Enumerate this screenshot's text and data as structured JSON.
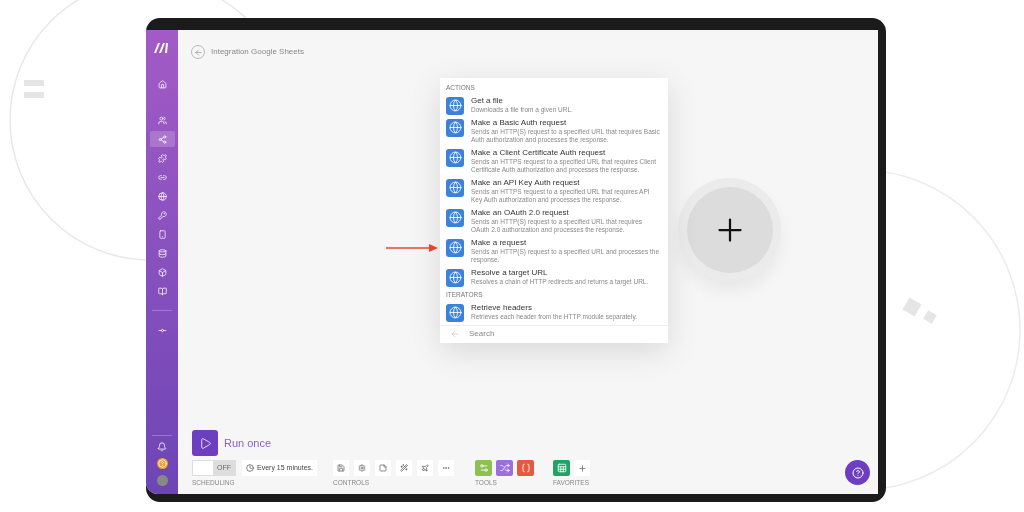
{
  "breadcrumb": "Integration Google Sheets",
  "sidebar": {
    "items": [
      {
        "selected": false
      },
      {
        "selected": false
      },
      {
        "selected": true
      },
      {
        "selected": false
      },
      {
        "selected": false
      },
      {
        "selected": false
      },
      {
        "selected": false
      },
      {
        "selected": false
      },
      {
        "selected": false
      },
      {
        "selected": false
      },
      {
        "selected": false
      },
      {
        "selected": false
      }
    ]
  },
  "module_menu": {
    "sections": [
      {
        "title": "ACTIONS",
        "items": [
          {
            "name": "Get a file",
            "description": "Downloads a file from a given URL."
          },
          {
            "name": "Make a Basic Auth request",
            "description": "Sends an HTTP(S) request to a specified URL that requires Basic Auth authorization and processes the response."
          },
          {
            "name": "Make a Client Certificate Auth request",
            "description": "Sends an HTTPS request to a specified URL that requires Client Certificate Auth authorization and processes the response."
          },
          {
            "name": "Make an API Key Auth request",
            "description": "Sends an HTTPS request to a specified URL that requires API Key Auth authorization and processes the response."
          },
          {
            "name": "Make an OAuth 2.0 request",
            "description": "Sends an HTTP(S) request to a specified URL that requires OAuth 2.0 authorization and processes the response."
          },
          {
            "name": "Make a request",
            "description": "Sends an HTTP(S) request to a specified URL and processes the response."
          },
          {
            "name": "Resolve a target URL",
            "description": "Resolves a chain of HTTP redirects and returns a target URL."
          }
        ]
      },
      {
        "title": "ITERATORS",
        "items": [
          {
            "name": "Retrieve headers",
            "description": "Retrieves each header from the HTTP module separately."
          }
        ]
      }
    ],
    "search": {
      "placeholder": "Search"
    }
  },
  "run_once": "Run once",
  "scheduling": {
    "on": false,
    "toggle_label": "OFF",
    "interval": "Every 15 minutes.",
    "label": "SCHEDULING"
  },
  "controls": {
    "label": "CONTROLS"
  },
  "tools": {
    "label": "TOOLS",
    "items": [
      {
        "color": "#8cc152"
      },
      {
        "color": "#9b6fdc"
      },
      {
        "color": "#e4593f"
      }
    ]
  },
  "favorites": {
    "label": "FAVORITES",
    "items": [
      {
        "color": "#21a366"
      }
    ]
  }
}
